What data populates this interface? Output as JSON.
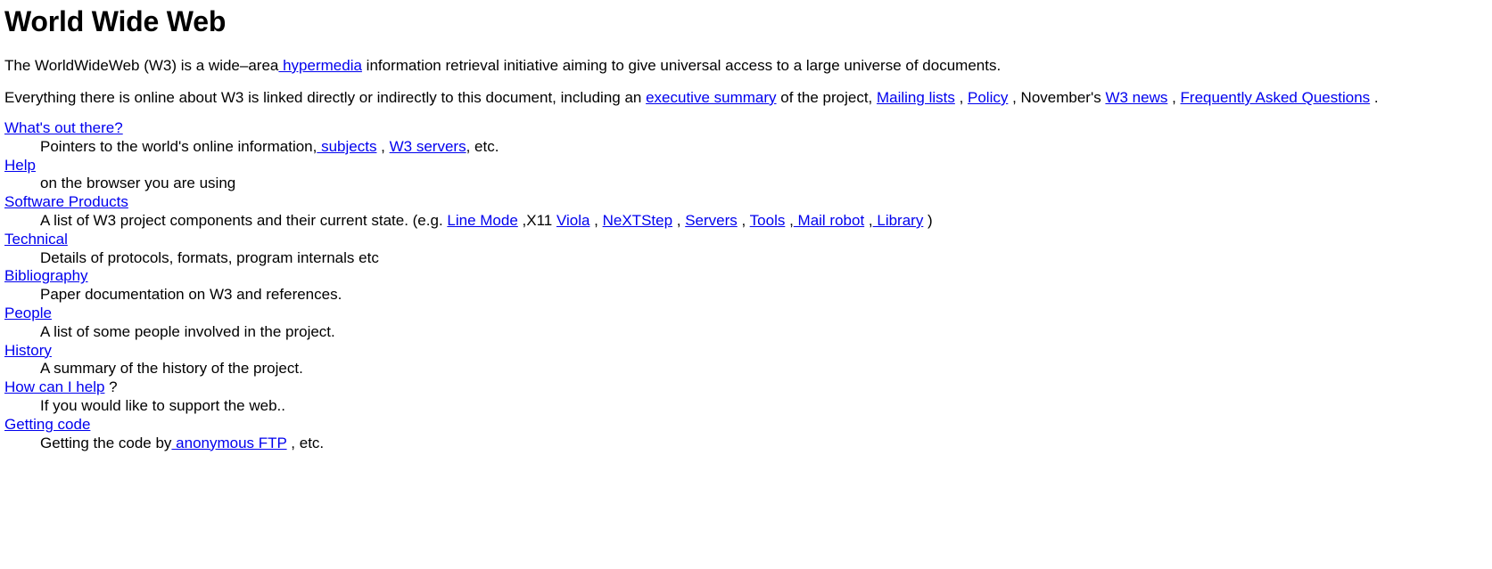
{
  "document": {
    "title": "World Wide Web",
    "link_color": "#0000ee",
    "text_color": "#000000",
    "background_color": "#ffffff"
  },
  "intro": {
    "p1_a": "The WorldWideWeb (W3) is a wide–area",
    "p1_link_hypermedia": " hypermedia",
    "p1_b": " information retrieval initiative aiming to give universal access to a large universe of documents.",
    "p2_a": "Everything there is online about W3 is linked directly or indirectly to this document, including an ",
    "p2_link_exec": "executive summary",
    "p2_b": " of the project, ",
    "p2_link_mailing": "Mailing lists",
    "p2_c": " , ",
    "p2_link_policy": "Policy",
    "p2_d": " , November's ",
    "p2_link_w3news": "W3 news",
    "p2_e": " , ",
    "p2_link_faq": "Frequently Asked Questions",
    "p2_f": " ."
  },
  "entries": [
    {
      "term": "What's out there?",
      "def_a": "Pointers to the world's online information,",
      "links": [
        {
          "label": " subjects",
          "sep": " , "
        },
        {
          "label": "W3 servers",
          "sep": ", etc."
        }
      ]
    },
    {
      "term": "Help",
      "def_a": "on the browser you are using",
      "links": []
    },
    {
      "term": "Software Products",
      "def_a": "A list of W3 project components and their current state. (e.g. ",
      "links": [
        {
          "label": "Line Mode",
          "sep": " ,X11 "
        },
        {
          "label": "Viola",
          "sep": " , "
        },
        {
          "label": "NeXTStep",
          "sep": " , "
        },
        {
          "label": "Servers",
          "sep": " , "
        },
        {
          "label": "Tools",
          "sep": " ,"
        },
        {
          "label": " Mail robot",
          "sep": " ,"
        },
        {
          "label": " Library",
          "sep": " )"
        }
      ]
    },
    {
      "term": "Technical",
      "def_a": "Details of protocols, formats, program internals etc",
      "links": []
    },
    {
      "term": "Bibliography",
      "def_a": "Paper documentation on W3 and references.",
      "links": []
    },
    {
      "term": "People",
      "def_a": "A list of some people involved in the project.",
      "links": []
    },
    {
      "term": "History",
      "def_a": "A summary of the history of the project.",
      "links": []
    },
    {
      "term": "How can I help",
      "term_suffix": " ?",
      "def_a": "If you would like to support the web..",
      "links": []
    },
    {
      "term": "Getting code",
      "def_a": "Getting the code by",
      "links": [
        {
          "label": " anonymous FTP",
          "sep": " , etc."
        }
      ]
    }
  ]
}
